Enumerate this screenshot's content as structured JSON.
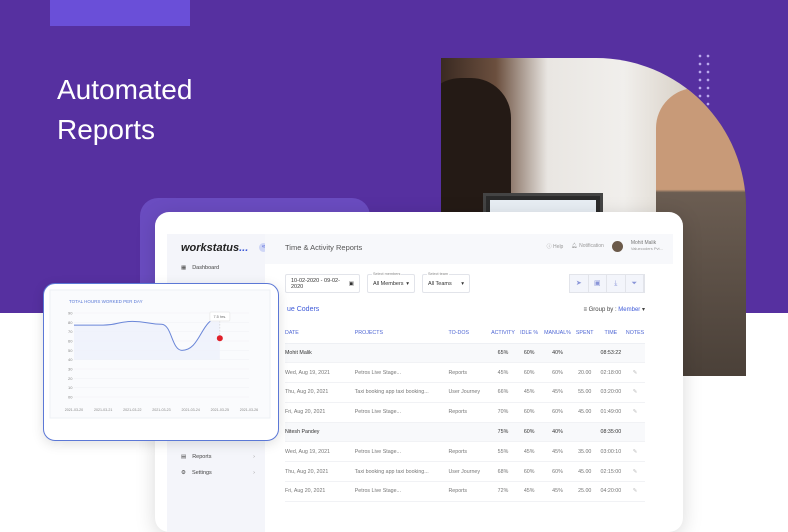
{
  "hero": {
    "headline_line1": "Automated",
    "headline_line2": "Reports"
  },
  "colors": {
    "background": "#5630a0",
    "accent": "#3f5bd9",
    "marker": "#e0202a"
  },
  "app": {
    "logo": "workstatus",
    "logo_dots": "...",
    "page_title": "Time & Activity Reports",
    "help": "Help",
    "notification": "Notification",
    "user_name": "Mohit Malik",
    "user_org": "Valuecoders Pvt..."
  },
  "sidebar": {
    "items": [
      {
        "label": "Dashboard",
        "icon": "dashboard-icon"
      },
      {
        "label": "Reports",
        "icon": "reports-icon"
      },
      {
        "label": "Settings",
        "icon": "gear-icon"
      }
    ]
  },
  "filters": {
    "date_range": "10-02-2020 - 09-02-2020",
    "members_label": "Select members",
    "members_value": "All Members",
    "team_label": "Select team",
    "team_value": "All Teams",
    "tools": [
      "send-icon",
      "calendar-icon",
      "download-icon",
      "filter-icon"
    ]
  },
  "org_name": "ue Coders",
  "group_by_label": "Group by :",
  "group_by_value": "Member",
  "table": {
    "headers": [
      "DATE",
      "PROJECTS",
      "TO-DOS",
      "ACTIVITY",
      "IDLE %",
      "MANUAL%",
      "SPENT",
      "TIME",
      "NOTES"
    ],
    "groups": [
      {
        "name": "Mohit Malik",
        "activity": "65%",
        "idle": "60%",
        "manual": "40%",
        "time": "08:53:22",
        "rows": [
          [
            "Wed, Aug 19, 2021",
            "Petros Live Stage...",
            "Reports",
            "45%",
            "60%",
            "60%",
            "20.00",
            "02:18:00"
          ],
          [
            "Thu, Aug 20, 2021",
            "Taxi booking app taxi booking...",
            "User Journey",
            "66%",
            "45%",
            "45%",
            "55.00",
            "03:20:00"
          ],
          [
            "Fri, Aug 20, 2021",
            "Petros Live Stage...",
            "Reports",
            "70%",
            "60%",
            "60%",
            "45.00",
            "01:49:00"
          ]
        ]
      },
      {
        "name": "Nitesh Pandey",
        "activity": "75%",
        "idle": "60%",
        "manual": "40%",
        "time": "08:35:00",
        "rows": [
          [
            "Wed, Aug 19, 2021",
            "Petros Live Stage...",
            "Reports",
            "55%",
            "45%",
            "45%",
            "35.00",
            "03:00:10"
          ],
          [
            "Thu, Aug 20, 2021",
            "Taxi booking app taxi booking...",
            "User Journey",
            "68%",
            "60%",
            "60%",
            "45.00",
            "02:15:00"
          ],
          [
            "Fri, Aug 20, 2021",
            "Petros Live Stage...",
            "Reports",
            "72%",
            "45%",
            "45%",
            "25.00",
            "04:20:00"
          ]
        ]
      }
    ]
  },
  "chart_data": {
    "type": "line",
    "title": "TOTAL HOURS WORKED PER DAY",
    "x": [
      "2021-03-20",
      "2021-03-21",
      "2021-03-22",
      "2021-03-23",
      "2021-03-24",
      "2021-03-25",
      "2021-03-26"
    ],
    "series": [
      {
        "x": [
          "2021-03-20",
          "2021-03-21",
          "2021-03-22",
          "2021-03-23",
          "2021-03-23.7",
          "2021-03-25"
        ],
        "values": [
          77,
          77,
          81,
          78,
          50,
          85
        ]
      }
    ],
    "marker": {
      "x": "2021-03-25",
      "y": 63
    },
    "tooltip": "7.5 hrs.",
    "yticks": [
      "90",
      "80",
      "70",
      "60",
      "50",
      "40",
      "30",
      "20",
      "10",
      "00"
    ],
    "ylim": [
      0,
      90
    ],
    "grid": true
  }
}
